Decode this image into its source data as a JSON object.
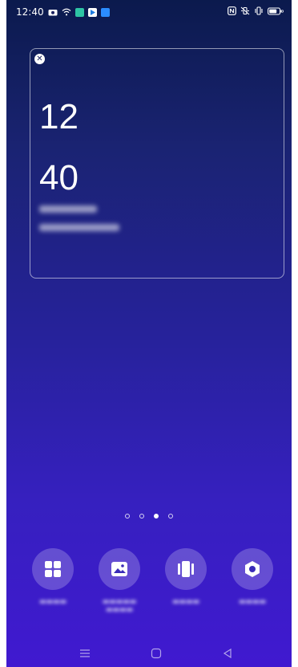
{
  "status_bar": {
    "time": "12:40",
    "left_icons": [
      "camera-icon",
      "wifi-icon",
      "app-icon",
      "play-store-icon",
      "app-blue-icon"
    ],
    "right_icons": [
      "nfc-icon",
      "vibrate-off-icon",
      "vibrate-icon",
      "battery-icon"
    ]
  },
  "widget": {
    "hour": "12",
    "minute": "40"
  },
  "home": {
    "page_count": 4,
    "active_page": 3
  },
  "actions": [
    {
      "icon": "widgets-icon"
    },
    {
      "icon": "wallpaper-icon"
    },
    {
      "icon": "effects-icon"
    },
    {
      "icon": "settings-icon"
    }
  ],
  "navbar": {
    "buttons": [
      "menu-icon",
      "home-icon",
      "back-icon"
    ]
  }
}
